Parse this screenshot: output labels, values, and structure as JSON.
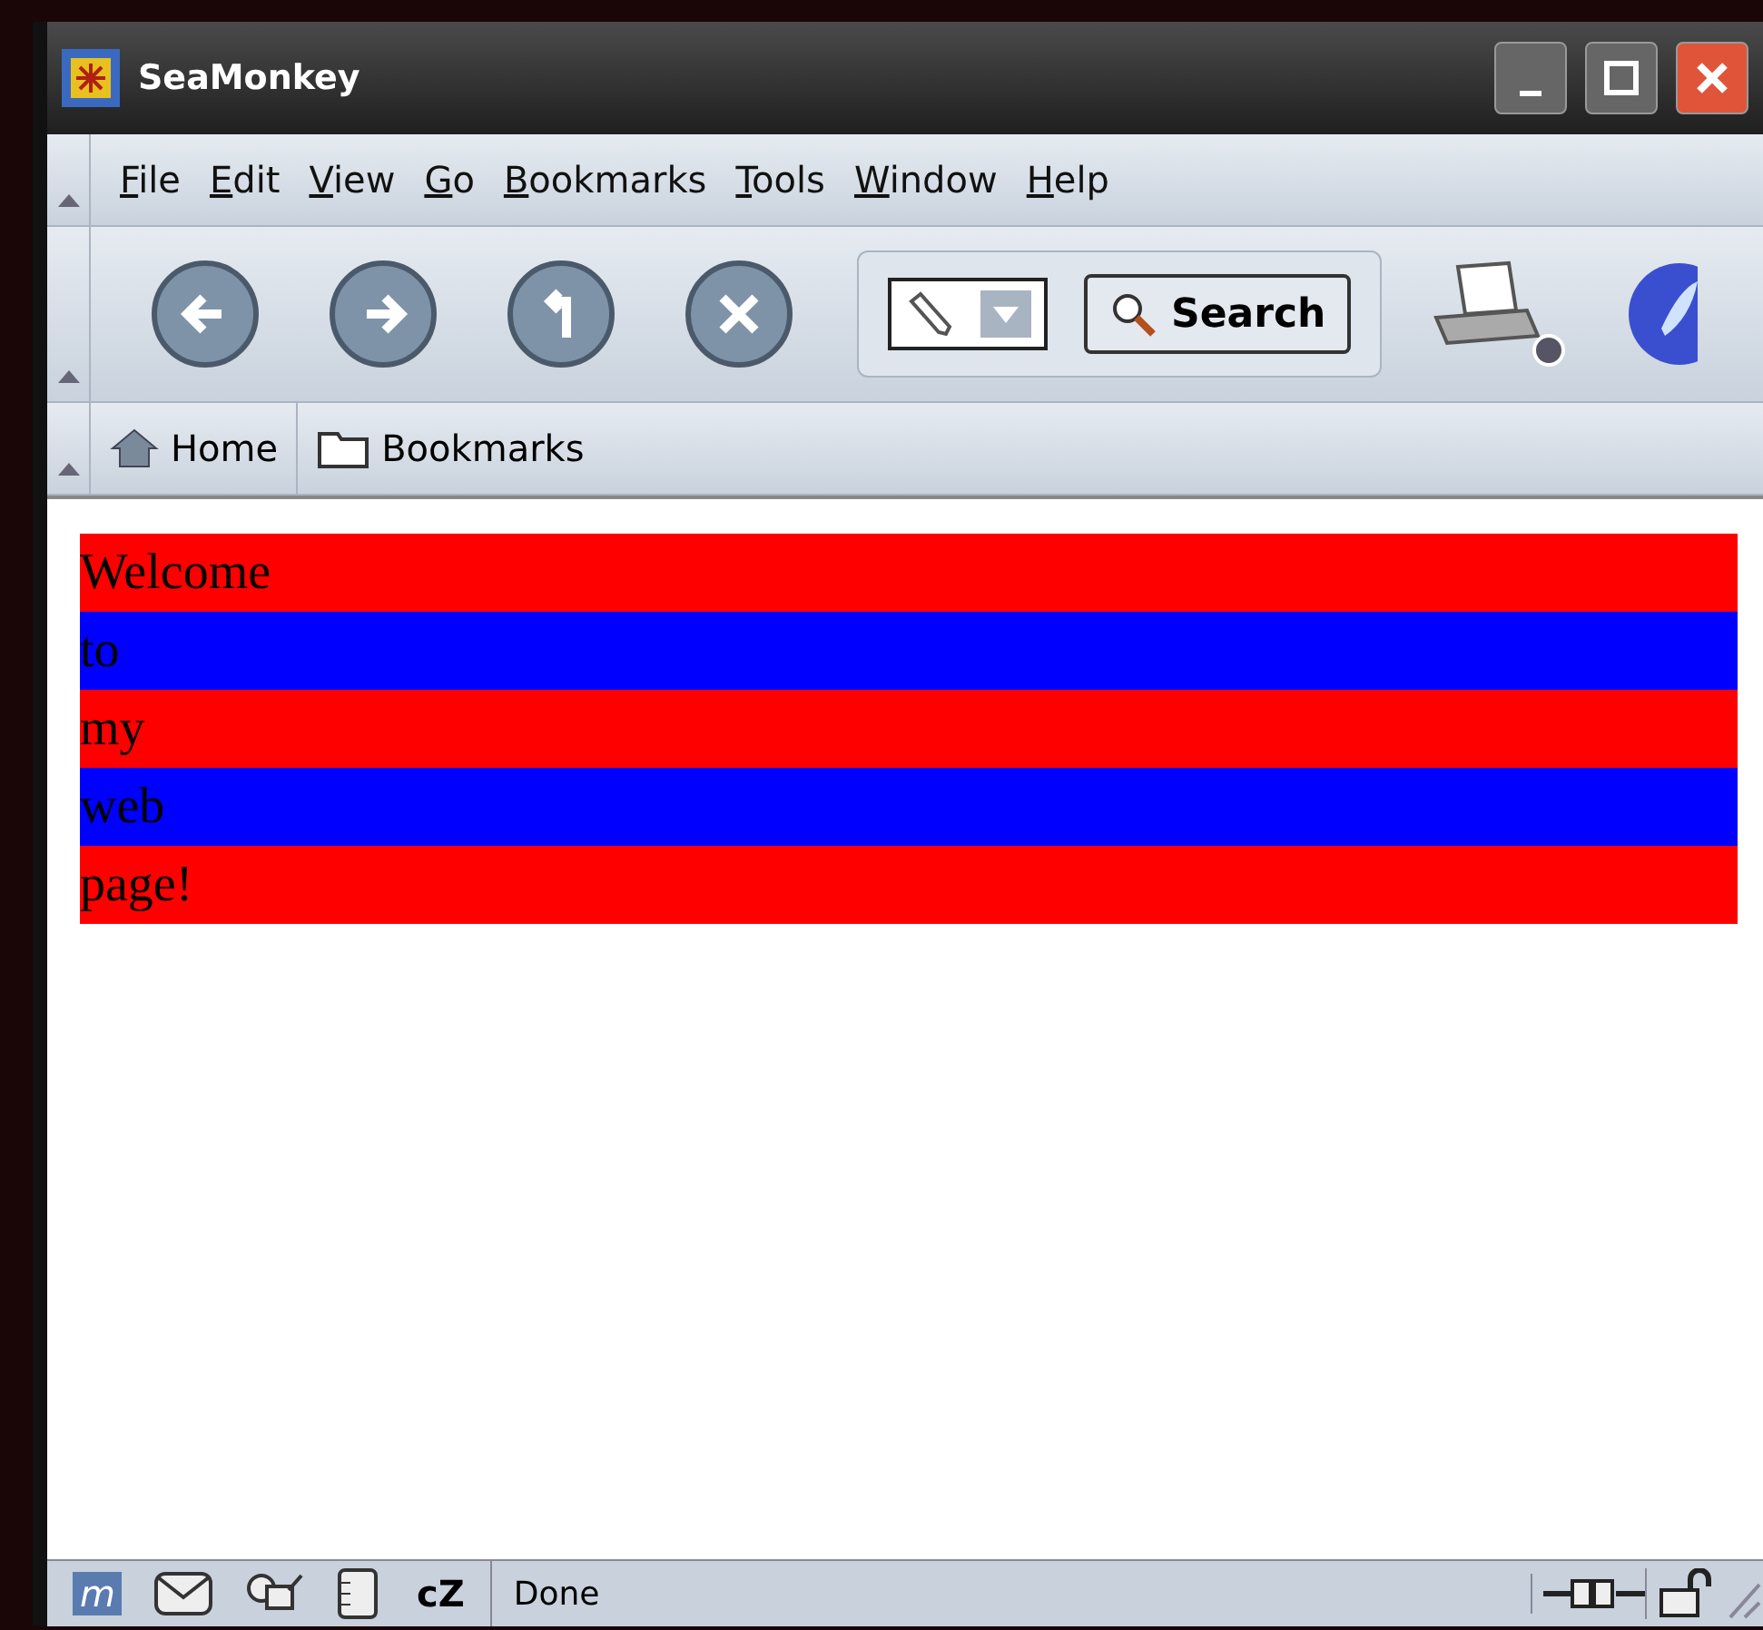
{
  "window": {
    "title": "SeaMonkey"
  },
  "menu": [
    "File",
    "Edit",
    "View",
    "Go",
    "Bookmarks",
    "Tools",
    "Window",
    "Help"
  ],
  "search_button": {
    "label": "Search"
  },
  "personal_toolbar": [
    {
      "label": "Home",
      "kind": "home"
    },
    {
      "label": "Bookmarks",
      "kind": "folder"
    }
  ],
  "page_lines": [
    {
      "text": "Welcome",
      "color": "#ff0000"
    },
    {
      "text": "to",
      "color": "#0000ff"
    },
    {
      "text": "my",
      "color": "#ff0000"
    },
    {
      "text": "web",
      "color": "#0000ff"
    },
    {
      "text": "page!",
      "color": "#ff0000"
    }
  ],
  "status_bar": {
    "component_icons": [
      "m",
      "cZ"
    ],
    "status": "Done"
  }
}
